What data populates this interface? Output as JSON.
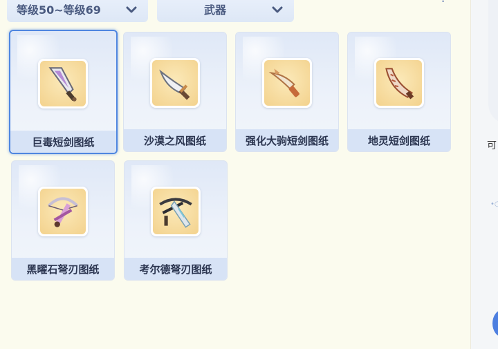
{
  "filters": {
    "level": "等级50~等级69",
    "type": "武器"
  },
  "help": "?",
  "items": [
    {
      "name": "巨毒短剑图纸",
      "icon": "dagger-blueprint-icon",
      "selected": true
    },
    {
      "name": "沙漠之风图纸",
      "icon": "scimitar-blueprint-icon",
      "selected": false
    },
    {
      "name": "强化大驹短剑图纸",
      "icon": "curved-dagger-blueprint-icon",
      "selected": false
    },
    {
      "name": "地灵短剑图纸",
      "icon": "fang-dagger-blueprint-icon",
      "selected": false
    },
    {
      "name": "黑曜石弩刃图纸",
      "icon": "crossbow-blueprint-icon",
      "selected": false
    },
    {
      "name": "考尔德弩刃图纸",
      "icon": "crossbow-blade-blueprint-icon",
      "selected": false
    }
  ],
  "right_panel": {
    "label": "可"
  },
  "colors": {
    "accent": "#4f86e0",
    "background": "#fbfbee",
    "label_bg": "#d7e3f6"
  }
}
